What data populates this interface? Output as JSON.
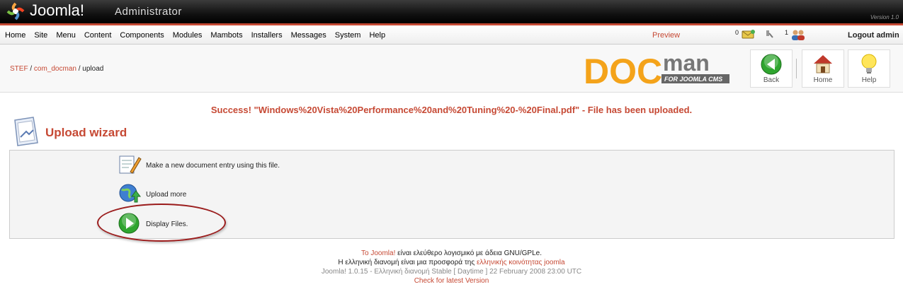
{
  "header": {
    "brand": "Joomla!",
    "subtitle": "Administrator",
    "version_tag": "Version 1.0"
  },
  "menu": {
    "items": [
      "Home",
      "Site",
      "Menu",
      "Content",
      "Components",
      "Modules",
      "Mambots",
      "Installers",
      "Messages",
      "System",
      "Help"
    ],
    "preview": "Preview",
    "messages_count": "0",
    "users_count": "1",
    "logout": "Logout admin"
  },
  "breadcrumb": {
    "part1": "STEF",
    "sep": " / ",
    "part2": "com_docman",
    "part3": "upload"
  },
  "toolbar": {
    "back": "Back",
    "home": "Home",
    "help": "Help",
    "logo_doc": "DOC",
    "logo_man": "man",
    "logo_tagline": "FOR JOOMLA CMS"
  },
  "main": {
    "success_message": "Success! \"Windows%20Vista%20Performance%20and%20Tuning%20-%20Final.pdf\" - File has been uploaded.",
    "title": "Upload wizard",
    "options": [
      "Make a new document entry using this file.",
      "Upload more",
      "Display Files."
    ]
  },
  "footer": {
    "line1_link": "To Joomla!",
    "line1_text": " είναι ελεύθερο λογισμικό με άδεια GNU/GPLe.",
    "line2_text": "Η ελληνική διανομή είναι μια προσφορά της ",
    "line2_link": "ελληνικής κοινότητας joomla",
    "line3": "Joomla! 1.0.15 - Ελληνική διανομή Stable [ Daytime ] 22 February 2008 23:00 UTC",
    "line4_link": "Check for latest Version"
  },
  "colors": {
    "accent": "#c64934",
    "docman_orange": "#f4a31a"
  }
}
